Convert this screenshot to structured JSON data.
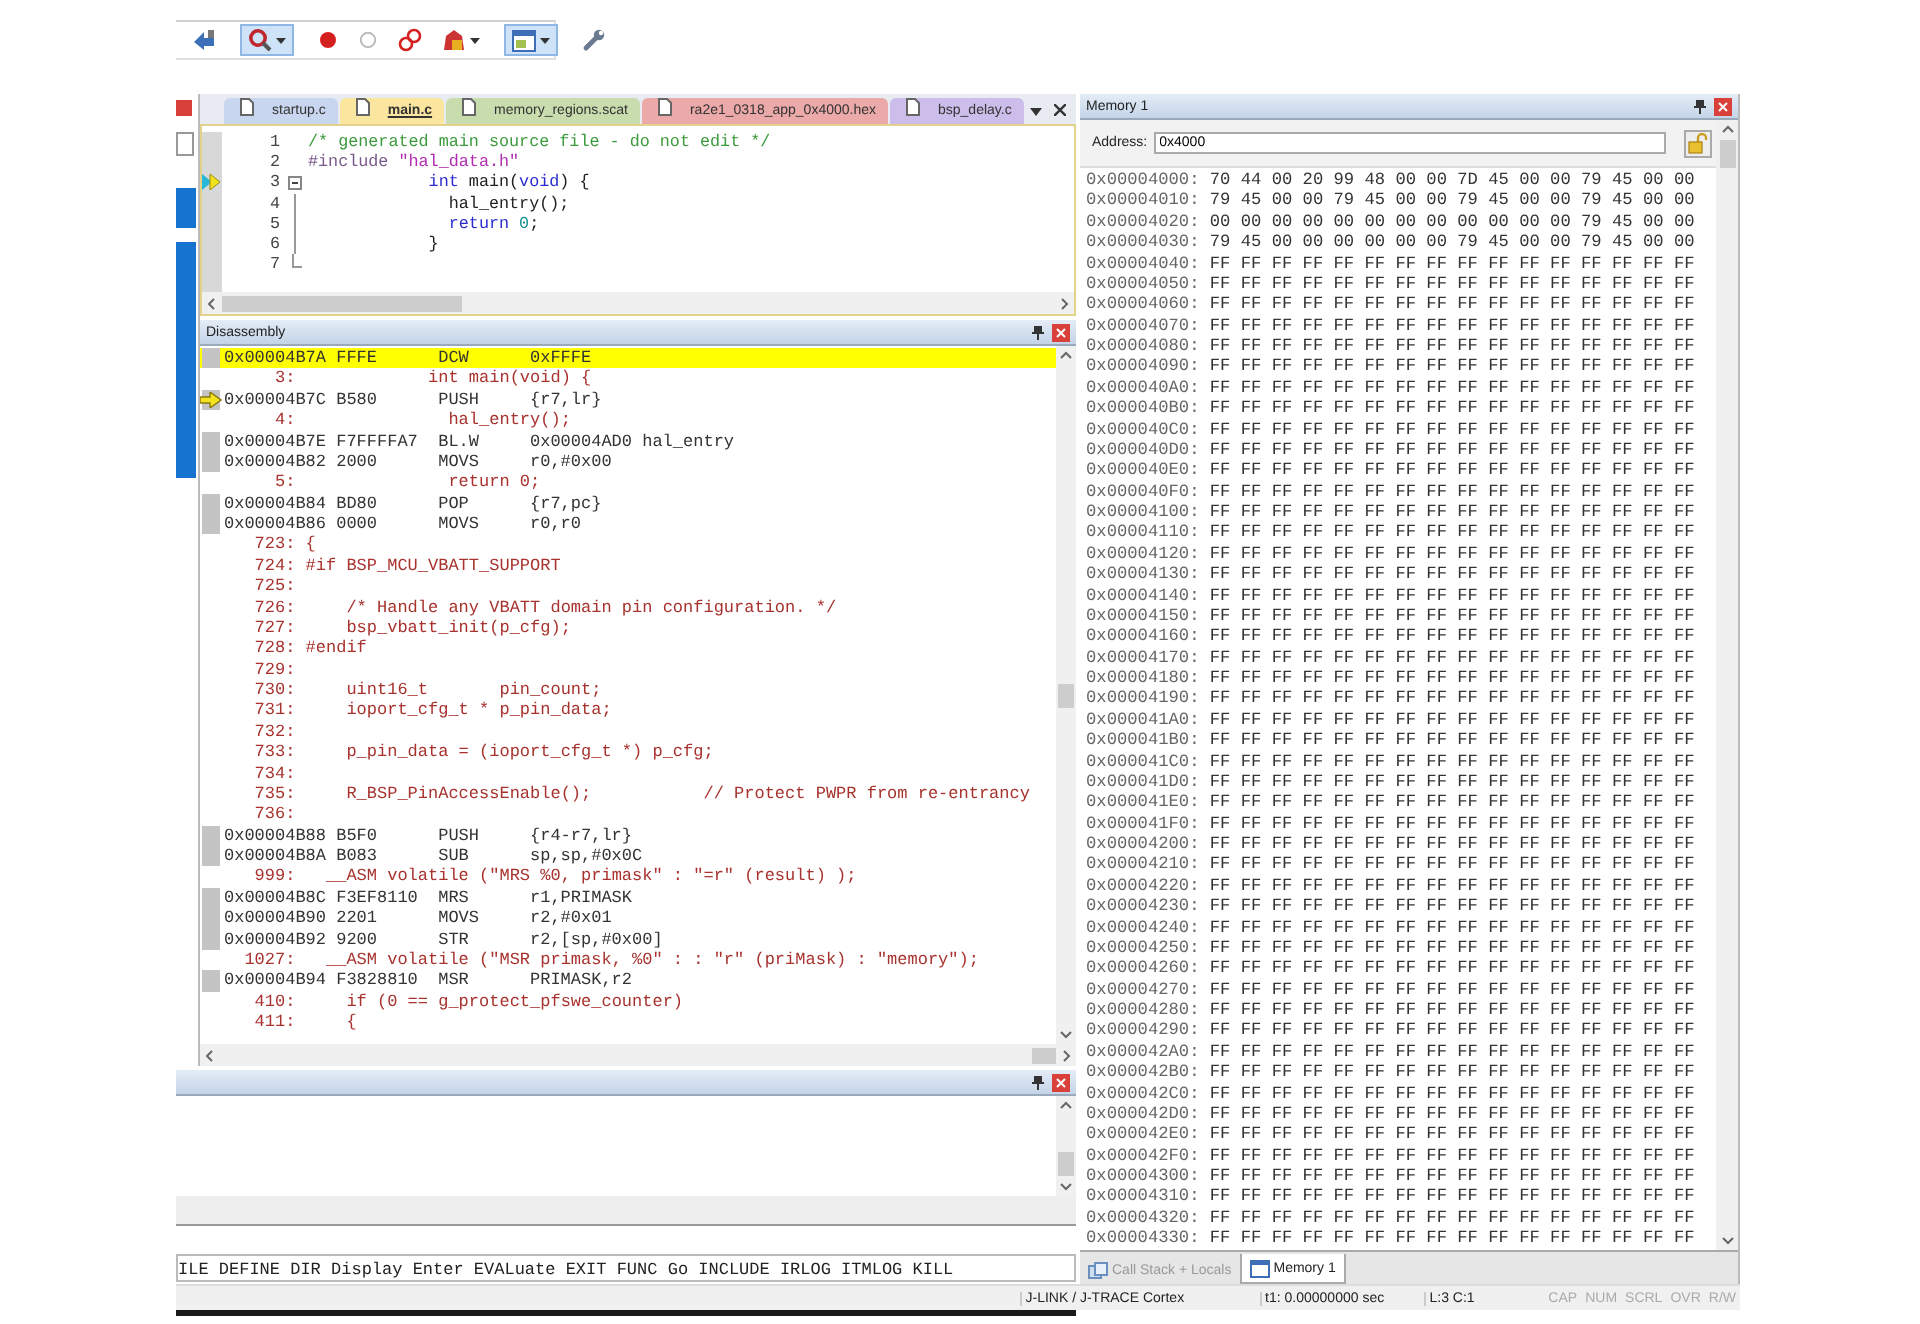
{
  "toolbar": {
    "groups": [
      {
        "buttons": [
          {
            "kind": "pointer",
            "active": false,
            "dropdown": false
          }
        ]
      },
      {
        "buttons": [
          {
            "kind": "zoom",
            "active": true,
            "dropdown": true
          }
        ]
      },
      {
        "buttons": [
          {
            "kind": "breakpoint",
            "active": false,
            "dropdown": false
          },
          {
            "kind": "breakpoint-off",
            "active": false,
            "dropdown": false
          },
          {
            "kind": "link",
            "active": false,
            "dropdown": false
          },
          {
            "kind": "analyze",
            "active": false,
            "dropdown": true
          }
        ]
      },
      {
        "buttons": [
          {
            "kind": "window",
            "active": true,
            "dropdown": true
          }
        ]
      },
      {
        "buttons": [
          {
            "kind": "wrench",
            "active": false,
            "dropdown": false
          }
        ]
      }
    ]
  },
  "editor": {
    "tabs": [
      {
        "label": "startup.c",
        "selected": false,
        "color": "#c9d6f0"
      },
      {
        "label": "main.c",
        "selected": true,
        "color": "#fbe6a0"
      },
      {
        "label": "memory_regions.scat",
        "selected": false,
        "color": "#c8dcae"
      },
      {
        "label": "ra2e1_0318_app_0x4000.hex",
        "selected": false,
        "color": "#eca9a9"
      },
      {
        "label": "bsp_delay.c",
        "selected": false,
        "color": "#cdbdea"
      }
    ],
    "lines": [
      {
        "number": "1",
        "pc_marker": false,
        "kind": "plain",
        "tokens": [
          {
            "kind": "comment",
            "text": "/* generated main source file - do not edit */"
          }
        ]
      },
      {
        "number": "2",
        "pc_marker": false,
        "kind": "plain",
        "tokens": [
          {
            "kind": "preproc",
            "text": "#include "
          },
          {
            "kind": "string",
            "text": "\"hal_data.h\""
          }
        ]
      },
      {
        "number": "3",
        "pc_marker": true,
        "kind": "fold-start",
        "tokens": [
          {
            "kind": "keyword",
            "text": "            int"
          },
          {
            "kind": "plain",
            "text": " main("
          },
          {
            "kind": "keyword",
            "text": "void"
          },
          {
            "kind": "plain",
            "text": ") {"
          }
        ]
      },
      {
        "number": "4",
        "pc_marker": false,
        "kind": "fold-inside",
        "tokens": [
          {
            "kind": "plain",
            "text": "              hal_entry();"
          }
        ]
      },
      {
        "number": "5",
        "pc_marker": false,
        "kind": "fold-inside",
        "tokens": [
          {
            "kind": "keyword",
            "text": "              return "
          },
          {
            "kind": "number",
            "text": "0"
          },
          {
            "kind": "plain",
            "text": ";"
          }
        ]
      },
      {
        "number": "6",
        "pc_marker": false,
        "kind": "fold-inside",
        "tokens": [
          {
            "kind": "plain",
            "text": "            }"
          }
        ]
      },
      {
        "number": "7",
        "pc_marker": false,
        "kind": "fold-end"
      }
    ]
  },
  "disassembly": {
    "title": "Disassembly",
    "rows": [
      {
        "kind": "asm",
        "address": "0x00004B7A",
        "opcode": "FFFE",
        "mnemonic": "DCW",
        "operands": "0xFFFE",
        "highlighted": true,
        "arrow": false
      },
      {
        "kind": "src",
        "line": "3:",
        "code": "            int main(void) {",
        "highlighted": false,
        "arrow": false
      },
      {
        "kind": "asm",
        "address": "0x00004B7C",
        "opcode": "B580",
        "mnemonic": "PUSH",
        "operands": "{r7,lr}",
        "highlighted": false,
        "arrow": true
      },
      {
        "kind": "src",
        "line": "4:",
        "code": "              hal_entry();",
        "highlighted": false,
        "arrow": false
      },
      {
        "kind": "asm",
        "address": "0x00004B7E",
        "opcode": "F7FFFFA7",
        "mnemonic": "BL.W",
        "operands": "0x00004AD0 hal_entry",
        "highlighted": false,
        "arrow": false
      },
      {
        "kind": "asm",
        "address": "0x00004B82",
        "opcode": "2000",
        "mnemonic": "MOVS",
        "operands": "r0,#0x00",
        "highlighted": false,
        "arrow": false
      },
      {
        "kind": "src",
        "line": "5:",
        "code": "              return 0;",
        "highlighted": false,
        "arrow": false
      },
      {
        "kind": "asm",
        "address": "0x00004B84",
        "opcode": "BD80",
        "mnemonic": "POP",
        "operands": "{r7,pc}",
        "highlighted": false,
        "arrow": false
      },
      {
        "kind": "asm",
        "address": "0x00004B86",
        "opcode": "0000",
        "mnemonic": "MOVS",
        "operands": "r0,r0",
        "highlighted": false,
        "arrow": false
      },
      {
        "kind": "src",
        "line": "723:",
        "code": "{",
        "highlighted": false,
        "arrow": false
      },
      {
        "kind": "src",
        "line": "724:",
        "code": "#if BSP_MCU_VBATT_SUPPORT",
        "highlighted": false,
        "arrow": false
      },
      {
        "kind": "src",
        "line": "725:",
        "code": "",
        "highlighted": false,
        "arrow": false
      },
      {
        "kind": "src",
        "line": "726:",
        "code": "    /* Handle any VBATT domain pin configuration. */",
        "highlighted": false,
        "arrow": false
      },
      {
        "kind": "src",
        "line": "727:",
        "code": "    bsp_vbatt_init(p_cfg);",
        "highlighted": false,
        "arrow": false
      },
      {
        "kind": "src",
        "line": "728:",
        "code": "#endif",
        "highlighted": false,
        "arrow": false
      },
      {
        "kind": "src",
        "line": "729:",
        "code": "",
        "highlighted": false,
        "arrow": false
      },
      {
        "kind": "src",
        "line": "730:",
        "code": "    uint16_t       pin_count;",
        "highlighted": false,
        "arrow": false
      },
      {
        "kind": "src",
        "line": "731:",
        "code": "    ioport_cfg_t * p_pin_data;",
        "highlighted": false,
        "arrow": false
      },
      {
        "kind": "src",
        "line": "732:",
        "code": "",
        "highlighted": false,
        "arrow": false
      },
      {
        "kind": "src",
        "line": "733:",
        "code": "    p_pin_data = (ioport_cfg_t *) p_cfg;",
        "highlighted": false,
        "arrow": false
      },
      {
        "kind": "src",
        "line": "734:",
        "code": "",
        "highlighted": false,
        "arrow": false
      },
      {
        "kind": "src",
        "line": "735:",
        "code": "    R_BSP_PinAccessEnable();           // Protect PWPR from re-entrancy",
        "highlighted": false,
        "arrow": false
      },
      {
        "kind": "src",
        "line": "736:",
        "code": "",
        "highlighted": false,
        "arrow": false
      },
      {
        "kind": "asm",
        "address": "0x00004B88",
        "opcode": "B5F0",
        "mnemonic": "PUSH",
        "operands": "{r4-r7,lr}",
        "highlighted": false,
        "arrow": false
      },
      {
        "kind": "asm",
        "address": "0x00004B8A",
        "opcode": "B083",
        "mnemonic": "SUB",
        "operands": "sp,sp,#0x0C",
        "highlighted": false,
        "arrow": false
      },
      {
        "kind": "src",
        "line": "999:",
        "code": "  __ASM volatile (\"MRS %0, primask\" : \"=r\" (result) );",
        "highlighted": false,
        "arrow": false
      },
      {
        "kind": "asm",
        "address": "0x00004B8C",
        "opcode": "F3EF8110",
        "mnemonic": "MRS",
        "operands": "r1,PRIMASK",
        "highlighted": false,
        "arrow": false
      },
      {
        "kind": "asm",
        "address": "0x00004B90",
        "opcode": "2201",
        "mnemonic": "MOVS",
        "operands": "r2,#0x01",
        "highlighted": false,
        "arrow": false
      },
      {
        "kind": "asm",
        "address": "0x00004B92",
        "opcode": "9200",
        "mnemonic": "STR",
        "operands": "r2,[sp,#0x00]",
        "highlighted": false,
        "arrow": false
      },
      {
        "kind": "src",
        "line": "1027:",
        "code": "  __ASM volatile (\"MSR primask, %0\" : : \"r\" (priMask) : \"memory\");",
        "highlighted": false,
        "arrow": false
      },
      {
        "kind": "asm",
        "address": "0x00004B94",
        "opcode": "F3828810",
        "mnemonic": "MSR",
        "operands": "PRIMASK,r2",
        "highlighted": false,
        "arrow": false
      },
      {
        "kind": "src",
        "line": "410:",
        "code": "    if (0 == g_protect_pfswe_counter)",
        "highlighted": false,
        "arrow": false
      },
      {
        "kind": "src",
        "line": "411:",
        "code": "    {",
        "highlighted": false,
        "arrow": false
      }
    ]
  },
  "command": {
    "line": "ILE DEFINE DIR Display Enter EVALuate EXIT FUNC Go INCLUDE IRLOG ITMLOG KILL"
  },
  "memory": {
    "title": "Memory 1",
    "address_label": "Address:",
    "address_value": "0x4000",
    "rows": [
      {
        "address": "0x00004000:",
        "bytes": "70 44 00 20 99 48 00 00 7D 45 00 00 79 45 00 00"
      },
      {
        "address": "0x00004010:",
        "bytes": "79 45 00 00 79 45 00 00 79 45 00 00 79 45 00 00"
      },
      {
        "address": "0x00004020:",
        "bytes": "00 00 00 00 00 00 00 00 00 00 00 00 79 45 00 00"
      },
      {
        "address": "0x00004030:",
        "bytes": "79 45 00 00 00 00 00 00 79 45 00 00 79 45 00 00"
      },
      {
        "address": "0x00004040:",
        "bytes": "FF FF FF FF FF FF FF FF FF FF FF FF FF FF FF FF"
      },
      {
        "address": "0x00004050:",
        "bytes": "FF FF FF FF FF FF FF FF FF FF FF FF FF FF FF FF"
      },
      {
        "address": "0x00004060:",
        "bytes": "FF FF FF FF FF FF FF FF FF FF FF FF FF FF FF FF"
      },
      {
        "address": "0x00004070:",
        "bytes": "FF FF FF FF FF FF FF FF FF FF FF FF FF FF FF FF"
      },
      {
        "address": "0x00004080:",
        "bytes": "FF FF FF FF FF FF FF FF FF FF FF FF FF FF FF FF"
      },
      {
        "address": "0x00004090:",
        "bytes": "FF FF FF FF FF FF FF FF FF FF FF FF FF FF FF FF"
      },
      {
        "address": "0x000040A0:",
        "bytes": "FF FF FF FF FF FF FF FF FF FF FF FF FF FF FF FF"
      },
      {
        "address": "0x000040B0:",
        "bytes": "FF FF FF FF FF FF FF FF FF FF FF FF FF FF FF FF"
      },
      {
        "address": "0x000040C0:",
        "bytes": "FF FF FF FF FF FF FF FF FF FF FF FF FF FF FF FF"
      },
      {
        "address": "0x000040D0:",
        "bytes": "FF FF FF FF FF FF FF FF FF FF FF FF FF FF FF FF"
      },
      {
        "address": "0x000040E0:",
        "bytes": "FF FF FF FF FF FF FF FF FF FF FF FF FF FF FF FF"
      },
      {
        "address": "0x000040F0:",
        "bytes": "FF FF FF FF FF FF FF FF FF FF FF FF FF FF FF FF"
      },
      {
        "address": "0x00004100:",
        "bytes": "FF FF FF FF FF FF FF FF FF FF FF FF FF FF FF FF"
      },
      {
        "address": "0x00004110:",
        "bytes": "FF FF FF FF FF FF FF FF FF FF FF FF FF FF FF FF"
      },
      {
        "address": "0x00004120:",
        "bytes": "FF FF FF FF FF FF FF FF FF FF FF FF FF FF FF FF"
      },
      {
        "address": "0x00004130:",
        "bytes": "FF FF FF FF FF FF FF FF FF FF FF FF FF FF FF FF"
      },
      {
        "address": "0x00004140:",
        "bytes": "FF FF FF FF FF FF FF FF FF FF FF FF FF FF FF FF"
      },
      {
        "address": "0x00004150:",
        "bytes": "FF FF FF FF FF FF FF FF FF FF FF FF FF FF FF FF"
      },
      {
        "address": "0x00004160:",
        "bytes": "FF FF FF FF FF FF FF FF FF FF FF FF FF FF FF FF"
      },
      {
        "address": "0x00004170:",
        "bytes": "FF FF FF FF FF FF FF FF FF FF FF FF FF FF FF FF"
      },
      {
        "address": "0x00004180:",
        "bytes": "FF FF FF FF FF FF FF FF FF FF FF FF FF FF FF FF"
      },
      {
        "address": "0x00004190:",
        "bytes": "FF FF FF FF FF FF FF FF FF FF FF FF FF FF FF FF"
      },
      {
        "address": "0x000041A0:",
        "bytes": "FF FF FF FF FF FF FF FF FF FF FF FF FF FF FF FF"
      },
      {
        "address": "0x000041B0:",
        "bytes": "FF FF FF FF FF FF FF FF FF FF FF FF FF FF FF FF"
      },
      {
        "address": "0x000041C0:",
        "bytes": "FF FF FF FF FF FF FF FF FF FF FF FF FF FF FF FF"
      },
      {
        "address": "0x000041D0:",
        "bytes": "FF FF FF FF FF FF FF FF FF FF FF FF FF FF FF FF"
      },
      {
        "address": "0x000041E0:",
        "bytes": "FF FF FF FF FF FF FF FF FF FF FF FF FF FF FF FF"
      },
      {
        "address": "0x000041F0:",
        "bytes": "FF FF FF FF FF FF FF FF FF FF FF FF FF FF FF FF"
      },
      {
        "address": "0x00004200:",
        "bytes": "FF FF FF FF FF FF FF FF FF FF FF FF FF FF FF FF"
      },
      {
        "address": "0x00004210:",
        "bytes": "FF FF FF FF FF FF FF FF FF FF FF FF FF FF FF FF"
      },
      {
        "address": "0x00004220:",
        "bytes": "FF FF FF FF FF FF FF FF FF FF FF FF FF FF FF FF"
      },
      {
        "address": "0x00004230:",
        "bytes": "FF FF FF FF FF FF FF FF FF FF FF FF FF FF FF FF"
      },
      {
        "address": "0x00004240:",
        "bytes": "FF FF FF FF FF FF FF FF FF FF FF FF FF FF FF FF"
      },
      {
        "address": "0x00004250:",
        "bytes": "FF FF FF FF FF FF FF FF FF FF FF FF FF FF FF FF"
      },
      {
        "address": "0x00004260:",
        "bytes": "FF FF FF FF FF FF FF FF FF FF FF FF FF FF FF FF"
      },
      {
        "address": "0x00004270:",
        "bytes": "FF FF FF FF FF FF FF FF FF FF FF FF FF FF FF FF"
      },
      {
        "address": "0x00004280:",
        "bytes": "FF FF FF FF FF FF FF FF FF FF FF FF FF FF FF FF"
      },
      {
        "address": "0x00004290:",
        "bytes": "FF FF FF FF FF FF FF FF FF FF FF FF FF FF FF FF"
      },
      {
        "address": "0x000042A0:",
        "bytes": "FF FF FF FF FF FF FF FF FF FF FF FF FF FF FF FF"
      },
      {
        "address": "0x000042B0:",
        "bytes": "FF FF FF FF FF FF FF FF FF FF FF FF FF FF FF FF"
      },
      {
        "address": "0x000042C0:",
        "bytes": "FF FF FF FF FF FF FF FF FF FF FF FF FF FF FF FF"
      },
      {
        "address": "0x000042D0:",
        "bytes": "FF FF FF FF FF FF FF FF FF FF FF FF FF FF FF FF"
      },
      {
        "address": "0x000042E0:",
        "bytes": "FF FF FF FF FF FF FF FF FF FF FF FF FF FF FF FF"
      },
      {
        "address": "0x000042F0:",
        "bytes": "FF FF FF FF FF FF FF FF FF FF FF FF FF FF FF FF"
      },
      {
        "address": "0x00004300:",
        "bytes": "FF FF FF FF FF FF FF FF FF FF FF FF FF FF FF FF"
      },
      {
        "address": "0x00004310:",
        "bytes": "FF FF FF FF FF FF FF FF FF FF FF FF FF FF FF FF"
      },
      {
        "address": "0x00004320:",
        "bytes": "FF FF FF FF FF FF FF FF FF FF FF FF FF FF FF FF"
      },
      {
        "address": "0x00004330:",
        "bytes": "FF FF FF FF FF FF FF FF FF FF FF FF FF FF FF FF"
      }
    ],
    "tabs": [
      {
        "label": "Call Stack + Locals",
        "selected": false
      },
      {
        "label": "Memory 1",
        "selected": true
      }
    ]
  },
  "status_bar": {
    "target": "J-LINK / J-TRACE Cortex",
    "time": "t1: 0.00000000 sec",
    "position": "L:3 C:1",
    "indicators": [
      {
        "label": "CAP",
        "on": false
      },
      {
        "label": "NUM",
        "on": false
      },
      {
        "label": "SCRL",
        "on": false
      },
      {
        "label": "OVR",
        "on": false
      },
      {
        "label": "R/W",
        "on": false
      }
    ]
  }
}
